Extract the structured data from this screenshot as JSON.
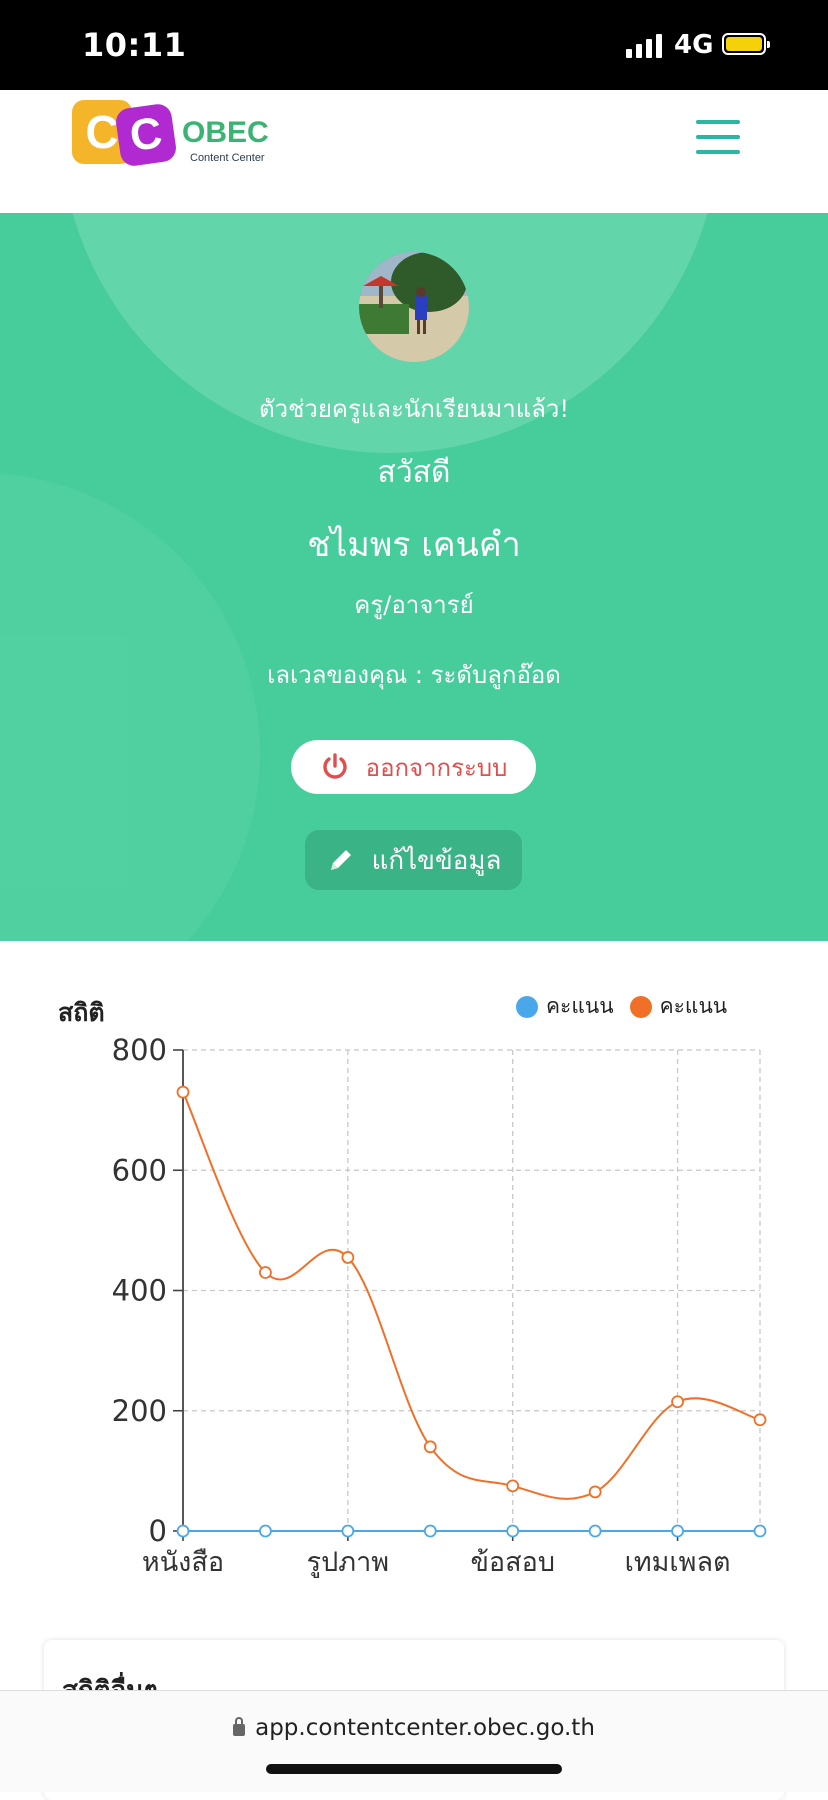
{
  "status_bar": {
    "time": "10:11",
    "network": "4G"
  },
  "header": {
    "logo_name": "OBEC",
    "logo_sub": "Content Center",
    "logo_c1": "C",
    "logo_c2": "C"
  },
  "profile": {
    "tagline": "ตัวช่วยครูและนักเรียนมาแล้ว!",
    "greeting": "สวัสดี",
    "name": "ชไมพร เคนคำ",
    "role": "ครู/อาจารย์",
    "level": "เลเวลของคุณ : ระดับลูกอ๊อด",
    "logout_label": "ออกจากระบบ",
    "edit_label": "แก้ไขข้อมูล"
  },
  "stats": {
    "title": "สถิติ",
    "legend": [
      {
        "label": "คะแนน",
        "color": "#4aa8ea"
      },
      {
        "label": "คะแนน",
        "color": "#f07028"
      }
    ]
  },
  "chart_data": {
    "type": "line",
    "title": "สถิติ",
    "x_tick_labels": [
      "หนังสือ",
      "รูปภาพ",
      "ข้อสอบ",
      "เทมเพลต"
    ],
    "ylim": [
      0,
      800
    ],
    "y_ticks": [
      0,
      200,
      400,
      600,
      800
    ],
    "grid": true,
    "legend_position": "top-right",
    "series": [
      {
        "name": "คะแนน",
        "color": "#4aa8ea",
        "values": [
          0,
          0,
          0,
          0,
          0,
          0,
          0,
          0
        ]
      },
      {
        "name": "คะแนน",
        "color": "#f07028",
        "values": [
          730,
          430,
          455,
          140,
          75,
          65,
          215,
          185
        ]
      }
    ]
  },
  "other_stats": {
    "title": "สถิติอื่นๆ"
  },
  "browser": {
    "url": "app.contentcenter.obec.go.th"
  }
}
